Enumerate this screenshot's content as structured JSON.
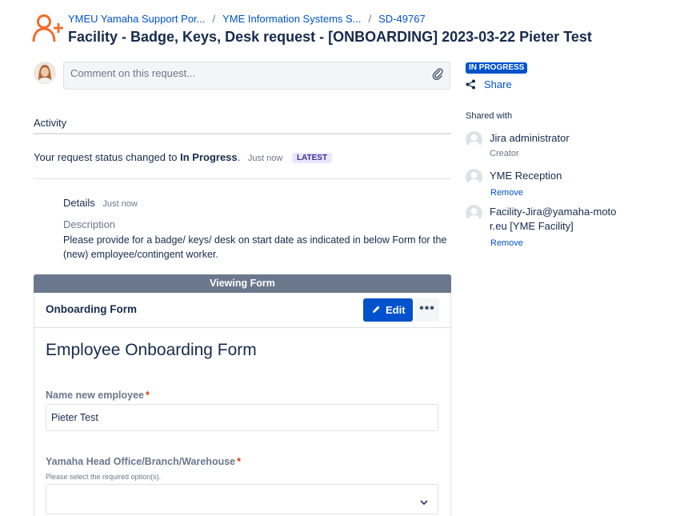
{
  "breadcrumbs": [
    {
      "label": "YMEU Yamaha Support Por..."
    },
    {
      "label": "YME Information Systems S..."
    },
    {
      "label": "SD-49767"
    }
  ],
  "page_title": "Facility - Badge, Keys, Desk request - [ONBOARDING] 2023-03-22 Pieter Test",
  "comment": {
    "placeholder": "Comment on this request..."
  },
  "activity": {
    "heading": "Activity",
    "status_prefix": "Your request status changed to",
    "status_value": "In Progress",
    "status_suffix": ".",
    "time": "Just now",
    "latest_badge": "LATEST"
  },
  "details": {
    "label": "Details",
    "time": "Just now",
    "description_label": "Description",
    "description_text": "Please provide for a badge/ keys/ desk on start date as indicated in below Form for the (new) employee/contingent worker."
  },
  "form": {
    "header": "Viewing Form",
    "card_title": "Onboarding Form",
    "edit_label": "Edit",
    "more_label": "•••",
    "title": "Employee Onboarding Form",
    "fields": [
      {
        "label": "Name new employee",
        "required_mark": "*",
        "value": "Pieter Test"
      },
      {
        "label": "Yamaha Head Office/Branch/Warehouse",
        "required_mark": "*",
        "hint": "Please select the required option(s).",
        "value": ""
      }
    ]
  },
  "sidebar": {
    "status": "IN PROGRESS",
    "share_label": "Share",
    "shared_with_label": "Shared with",
    "people": [
      {
        "name": "Jira administrator",
        "sub": "Creator"
      },
      {
        "name": "YME Reception",
        "action": "Remove"
      },
      {
        "name": "Facility-Jira@yamaha-motor.eu [YME Facility]",
        "action": "Remove"
      }
    ]
  },
  "colors": {
    "brand_orange": "#f26b2a",
    "link_blue": "#0052cc",
    "form_header_gray": "#6b778c",
    "latest_badge_bg": "#eae6ff",
    "required_red": "#de350b"
  },
  "icons": [
    "user-add-icon",
    "paperclip-icon",
    "share-icon",
    "pencil-icon",
    "chevron-down-icon"
  ]
}
